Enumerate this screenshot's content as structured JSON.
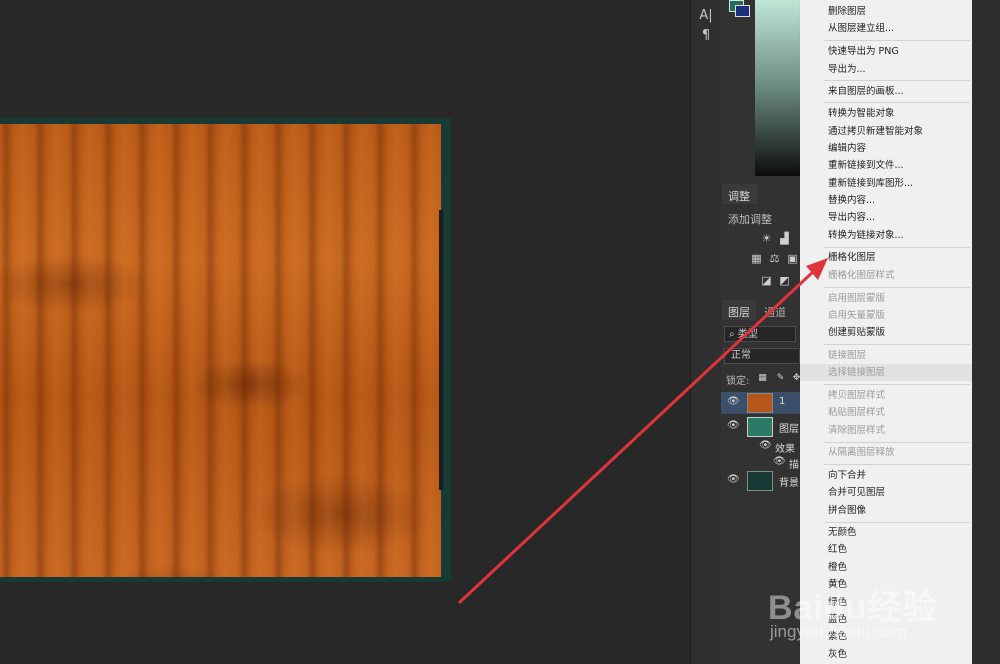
{
  "toolstrip": {
    "items": [
      "A|",
      "¶"
    ]
  },
  "panels": {
    "adjust_tab": "调整",
    "adjust_label": "添加调整",
    "layers_tab": "图层",
    "channels_tab": "通道",
    "search_label": "⌕ 类型",
    "blend_mode": "正常",
    "lock_label": "锁定:",
    "layers": [
      {
        "name": "1",
        "selected": true,
        "eye": "👁"
      },
      {
        "name": "图层",
        "selected": false,
        "eye": "👁"
      },
      {
        "name": "效果",
        "selected": false,
        "eye": "👁"
      },
      {
        "name": "描",
        "selected": false,
        "eye": "👁"
      },
      {
        "name": "背景",
        "selected": false,
        "eye": "👁"
      }
    ]
  },
  "menu": {
    "items": [
      {
        "label": "删除图层",
        "disabled": false
      },
      {
        "label": "从图层建立组...",
        "disabled": false
      },
      {
        "label": "快速导出为 PNG",
        "disabled": false
      },
      {
        "label": "导出为...",
        "disabled": false
      },
      {
        "label": "来自图层的画板...",
        "disabled": false
      },
      {
        "label": "转换为智能对象",
        "disabled": false
      },
      {
        "label": "通过拷贝新建智能对象",
        "disabled": false
      },
      {
        "label": "编辑内容",
        "disabled": false
      },
      {
        "label": "重新链接到文件...",
        "disabled": false
      },
      {
        "label": "重新链接到库图形...",
        "disabled": false
      },
      {
        "label": "替换内容...",
        "disabled": false
      },
      {
        "label": "导出内容...",
        "disabled": false
      },
      {
        "label": "转换为链接对象...",
        "disabled": false
      },
      {
        "label": "栅格化图层",
        "disabled": false
      },
      {
        "label": "栅格化图层样式",
        "disabled": true
      },
      {
        "label": "启用图层蒙版",
        "disabled": true
      },
      {
        "label": "启用矢量蒙版",
        "disabled": true
      },
      {
        "label": "创建剪贴蒙版",
        "disabled": false
      },
      {
        "label": "链接图层",
        "disabled": true
      },
      {
        "label": "选择链接图层",
        "disabled": true
      },
      {
        "label": "拷贝图层样式",
        "disabled": true
      },
      {
        "label": "粘贴图层样式",
        "disabled": true
      },
      {
        "label": "清除图层样式",
        "disabled": true
      },
      {
        "label": "从隔离图层释放",
        "disabled": true
      },
      {
        "label": "向下合并",
        "disabled": false
      },
      {
        "label": "合并可见图层",
        "disabled": false
      },
      {
        "label": "拼合图像",
        "disabled": false
      },
      {
        "label": "无颜色",
        "disabled": false
      },
      {
        "label": "红色",
        "disabled": false
      },
      {
        "label": "橙色",
        "disabled": false
      },
      {
        "label": "黄色",
        "disabled": false
      },
      {
        "label": "绿色",
        "disabled": false
      },
      {
        "label": "蓝色",
        "disabled": false
      },
      {
        "label": "紫色",
        "disabled": false
      },
      {
        "label": "灰色",
        "disabled": false
      }
    ]
  },
  "watermark": {
    "line1": "Baidu经验",
    "line2": "jingyan.baidu.com"
  },
  "colors": {
    "arrow": "#e0343c",
    "menu_bg": "#f0f0f0",
    "selected_layer": "#3b4f6a"
  }
}
